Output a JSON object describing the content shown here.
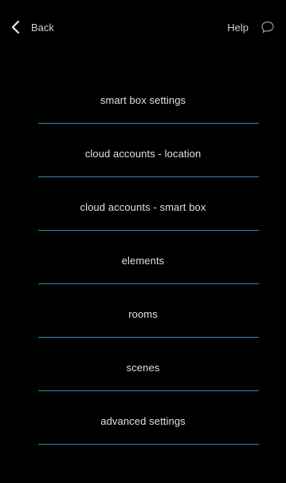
{
  "header": {
    "back_label": "Back",
    "help_label": "Help",
    "back_icon": "chevron-left-icon",
    "help_icon": "chat-bubble-icon"
  },
  "menu": {
    "items": [
      {
        "label": "smart box settings"
      },
      {
        "label": "cloud accounts - location"
      },
      {
        "label": "cloud accounts - smart box"
      },
      {
        "label": "elements"
      },
      {
        "label": "rooms"
      },
      {
        "label": "scenes"
      },
      {
        "label": "advanced settings"
      }
    ]
  },
  "colors": {
    "background": "#000000",
    "divider": "#2c86b0",
    "text": "#e0e0e0"
  }
}
